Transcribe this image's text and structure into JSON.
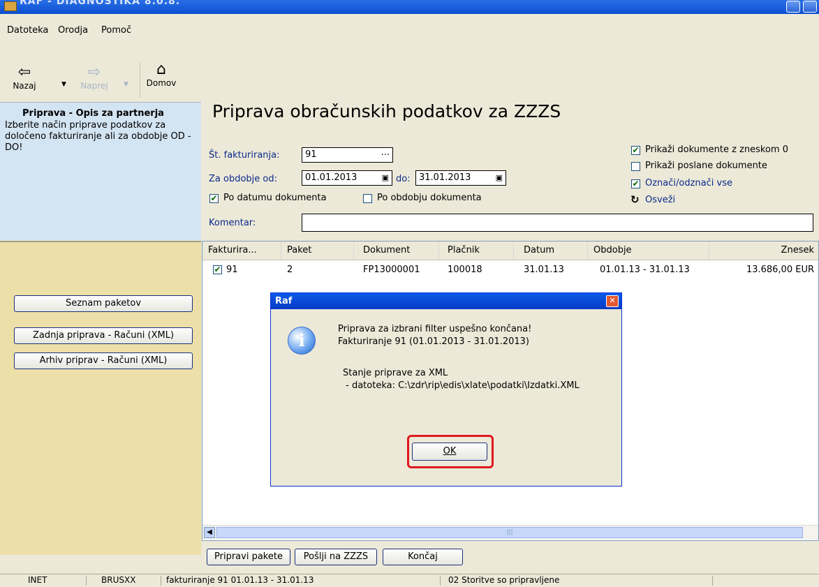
{
  "window": {
    "title": "RAF - DIAGNOSTIKA 8.0.8."
  },
  "menu": [
    "Datoteka",
    "Orodja",
    "Pomoč"
  ],
  "toolbar": {
    "back": "Nazaj",
    "forward": "Naprej",
    "home": "Domov"
  },
  "sidebar": {
    "heading": "Priprava - Opis za partnerja",
    "description": "Izberite način priprave podatkov za določeno fakturiranje ali za obdobje OD - DO!",
    "buttons": [
      "Seznam paketov",
      "Zadnja priprava - Računi (XML)",
      "Arhiv priprav - Računi (XML)"
    ]
  },
  "main": {
    "title": "Priprava obračunskih podatkov za ZZZS",
    "invoice_label": "Št. fakturiranja:",
    "invoice_value": "91",
    "period_from_label": "Za obdobje od:",
    "period_from": "01.01.2013",
    "period_to_label": "do:",
    "period_to": "31.01.2013",
    "by_doc_date": "Po datumu dokumenta",
    "by_doc_period": "Po obdobju dokumenta",
    "show_zero": "Prikaži dokumente z zneskom 0",
    "show_sent": "Prikaži poslane dokumente",
    "toggle_all": "Označi/odznači vse",
    "refresh": "Osveži",
    "comment_label": "Komentar:"
  },
  "grid": {
    "columns": [
      "Fakturira...",
      "Paket",
      "Dokument",
      "Plačnik",
      "Datum",
      "Obdobje",
      "Znesek"
    ],
    "rows": [
      {
        "fakturiranje": "91",
        "paket": "2",
        "dokument": "FP13000001",
        "placnik": "100018",
        "datum": "31.01.13",
        "obdobje": "01.01.13 - 31.01.13",
        "znesek": "13.686,00 EUR"
      }
    ]
  },
  "buttons": {
    "prepare": "Pripravi pakete",
    "send": "Pošlji na ZZZS",
    "finish": "Končaj"
  },
  "status": [
    "INET",
    "BRUSXX",
    "fakturiranje 91  01.01.13 - 31.01.13",
    "02 Storitve so pripravljene"
  ],
  "dialog": {
    "title": "Raf",
    "line1": "Priprava za izbrani filter uspešno končana!",
    "line2": "Fakturiranje 91 (01.01.2013 - 31.01.2013)",
    "line3": "Stanje priprave za XML",
    "line4": " - datoteka: C:\\zdr\\rip\\edis\\xlate\\podatki\\Izdatki.XML",
    "ok": "OK"
  }
}
